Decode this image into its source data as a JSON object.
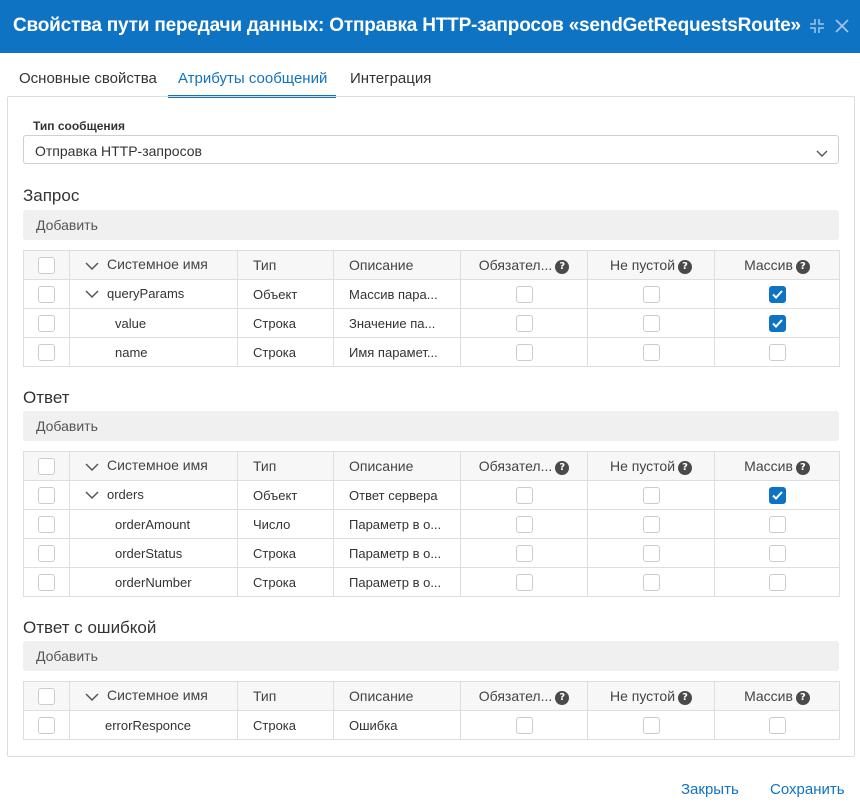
{
  "header": {
    "title": "Свойства пути передачи данных: Отправка HTTP-запросов «sendGetRequestsRoute»"
  },
  "tabs": [
    {
      "label": "Основные свойства"
    },
    {
      "label": "Атрибуты сообщений"
    },
    {
      "label": "Интеграция"
    }
  ],
  "message_type": {
    "label": "Тип сообщения",
    "value": "Отправка HTTP-запросов"
  },
  "columns": {
    "name": "Системное имя",
    "type": "Тип",
    "description": "Описание",
    "required": "Обязател...",
    "not_empty": "Не пустой",
    "array": "Массив"
  },
  "request": {
    "title": "Запрос",
    "add_label": "Добавить",
    "rows": [
      {
        "name": "queryParams",
        "type": "Объект",
        "description": "Массив пара...",
        "required": false,
        "not_empty": false,
        "array": true
      },
      {
        "name": "value",
        "type": "Строка",
        "description": "Значение па...",
        "required": false,
        "not_empty": false,
        "array": true
      },
      {
        "name": "name",
        "type": "Строка",
        "description": "Имя парамет...",
        "required": false,
        "not_empty": false,
        "array": false
      }
    ]
  },
  "response": {
    "title": "Ответ",
    "add_label": "Добавить",
    "rows": [
      {
        "name": "orders",
        "type": "Объект",
        "description": "Ответ сервера",
        "required": false,
        "not_empty": false,
        "array": true
      },
      {
        "name": "orderAmount",
        "type": "Число",
        "description": "Параметр в о...",
        "required": false,
        "not_empty": false,
        "array": false
      },
      {
        "name": "orderStatus",
        "type": "Строка",
        "description": "Параметр в о...",
        "required": false,
        "not_empty": false,
        "array": false
      },
      {
        "name": "orderNumber",
        "type": "Строка",
        "description": "Параметр в о...",
        "required": false,
        "not_empty": false,
        "array": false
      }
    ]
  },
  "error_response": {
    "title": "Ответ с ошибкой",
    "add_label": "Добавить",
    "rows": [
      {
        "name": "errorResponce",
        "type": "Строка",
        "description": "Ошибка",
        "required": false,
        "not_empty": false,
        "array": false
      }
    ]
  },
  "footer": {
    "close_label": "Закрыть",
    "save_label": "Сохранить"
  },
  "colors": {
    "accent": "#0f73c4"
  }
}
